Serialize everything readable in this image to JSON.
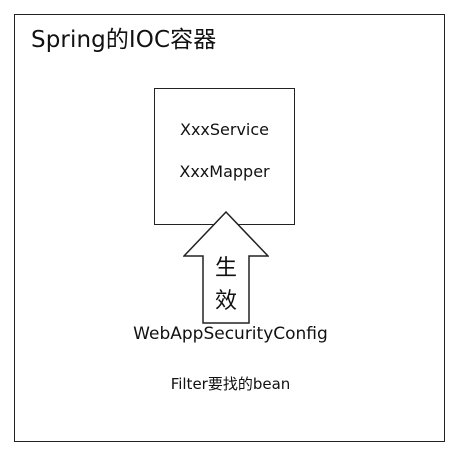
{
  "diagram": {
    "title": "Spring的IOC容器",
    "container_beans": [
      "XxxService",
      "XxxMapper"
    ],
    "arrow_label": [
      "生",
      "效"
    ],
    "config_label": "WebAppSecurityConfig",
    "filter_label": "Filter要找的bean"
  },
  "colors": {
    "stroke": "#222222",
    "background": "#ffffff",
    "text": "#111111"
  }
}
